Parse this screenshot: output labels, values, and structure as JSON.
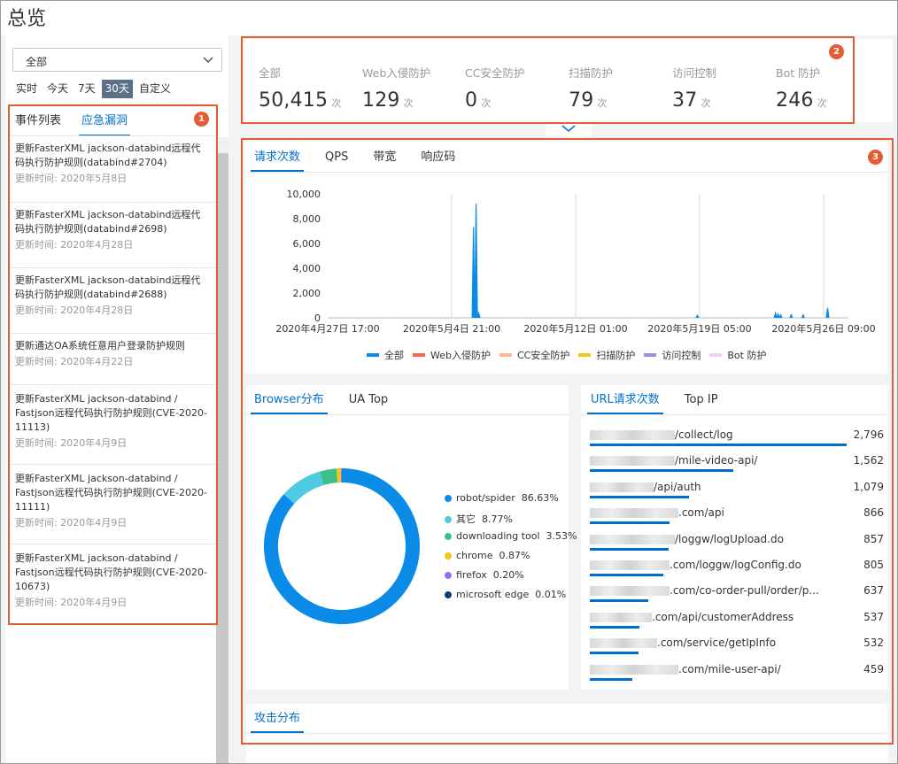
{
  "page": {
    "title": "总览"
  },
  "filter": {
    "select_value": "全部",
    "ranges": [
      "实时",
      "今天",
      "7天",
      "30天",
      "自定义"
    ],
    "active_range": "30天"
  },
  "left_tabs": [
    "事件列表",
    "应急漏洞"
  ],
  "events": [
    {
      "title": "更新FasterXML jackson-databind远程代码执行防护规则(databind#2704)",
      "date": "更新时间: 2020年5月8日"
    },
    {
      "title": "更新FasterXML jackson-databind远程代码执行防护规则(databind#2698)",
      "date": "更新时间: 2020年4月28日"
    },
    {
      "title": "更新FasterXML jackson-databind远程代码执行防护规则(databind#2688)",
      "date": "更新时间: 2020年4月28日"
    },
    {
      "title": "更新通达OA系统任意用户登录防护规则",
      "date": "更新时间: 2020年4月22日"
    },
    {
      "title": "更新FasterXML jackson-databind / Fastjson远程代码执行防护规则(CVE-2020-11113)",
      "date": "更新时间: 2020年4月9日"
    },
    {
      "title": "更新FasterXML jackson-databind / Fastjson远程代码执行防护规则(CVE-2020-11111)",
      "date": "更新时间: 2020年4月9日"
    },
    {
      "title": "更新FasterXML jackson-databind / Fastjson远程代码执行防护规则(CVE-2020-10673)",
      "date": "更新时间: 2020年4月9日"
    }
  ],
  "badges": [
    "1",
    "2",
    "3"
  ],
  "stats": [
    {
      "label": "全部",
      "value": "50,415",
      "unit": "次"
    },
    {
      "label": "Web入侵防护",
      "value": "129",
      "unit": "次"
    },
    {
      "label": "CC安全防护",
      "value": "0",
      "unit": "次"
    },
    {
      "label": "扫描防护",
      "value": "79",
      "unit": "次"
    },
    {
      "label": "访问控制",
      "value": "37",
      "unit": "次"
    },
    {
      "label": "Bot 防护",
      "value": "246",
      "unit": "次"
    }
  ],
  "chart_tabs": [
    "请求次数",
    "QPS",
    "带宽",
    "响应码"
  ],
  "chart_data": [
    {
      "type": "line",
      "x_tick_labels": [
        "2020年4月27日 17:00",
        "2020年5月4日 21:00",
        "2020年5月12日 01:00",
        "2020年5月19日 05:00",
        "2020年5月26日 09:00"
      ],
      "y_tick_labels": [
        "10,000",
        "8,000",
        "6,000",
        "4,000",
        "2,000",
        "0"
      ],
      "ylim": [
        0,
        10000
      ],
      "legend": [
        {
          "name": "全部",
          "color": "#0a8be8"
        },
        {
          "name": "Web入侵防护",
          "color": "#f46a4a"
        },
        {
          "name": "CC安全防护",
          "color": "#fdb98c"
        },
        {
          "name": "扫描防护",
          "color": "#f5c518"
        },
        {
          "name": "访问控制",
          "color": "#9a8cf0"
        },
        {
          "name": "Bot 防护",
          "color": "#f3cdf3"
        }
      ],
      "series": [
        {
          "name": "全部",
          "spikes": [
            {
              "t": 0.28,
              "v": 7300
            },
            {
              "t": 0.285,
              "v": 9200
            },
            {
              "t": 0.29,
              "v": 400
            },
            {
              "t": 0.71,
              "v": 200
            },
            {
              "t": 0.86,
              "v": 400
            },
            {
              "t": 0.865,
              "v": 300
            },
            {
              "t": 0.87,
              "v": 250
            },
            {
              "t": 0.89,
              "v": 250
            },
            {
              "t": 0.913,
              "v": 250
            },
            {
              "t": 0.96,
              "v": 800
            }
          ]
        }
      ]
    },
    {
      "type": "pie",
      "labels": [
        "robot/spider",
        "其它",
        "downloading tool",
        "chrome",
        "firefox",
        "microsoft edge"
      ],
      "values": [
        86.63,
        8.77,
        3.53,
        0.87,
        0.2,
        0.01
      ],
      "display": [
        "86.63%",
        "8.77%",
        "3.53%",
        "0.87%",
        "0.20%",
        "0.01%"
      ],
      "colors": [
        "#0a8be8",
        "#4ecbe0",
        "#3ebf8a",
        "#f5c518",
        "#9a6cf0",
        "#0f3c6e"
      ]
    }
  ],
  "browser_tabs": [
    "Browser分布",
    "UA Top"
  ],
  "url_tabs": [
    "URL请求次数",
    "Top IP"
  ],
  "urls": [
    {
      "path": "/collect/log",
      "count": "2,796",
      "value": 2796
    },
    {
      "path": "/mile-video-api/",
      "count": "1,562",
      "value": 1562
    },
    {
      "path": "/api/auth",
      "count": "1,079",
      "value": 1079
    },
    {
      "path": ".com/api",
      "count": "866",
      "value": 866
    },
    {
      "path": "/loggw/logUpload.do",
      "count": "857",
      "value": 857
    },
    {
      "path": ".com/loggw/logConfig.do",
      "count": "805",
      "value": 805
    },
    {
      "path": ".com/co-order-pull/order/p...",
      "count": "637",
      "value": 637
    },
    {
      "path": ".com/api/customerAddress",
      "count": "537",
      "value": 537
    },
    {
      "path": ".com/service/getIpInfo",
      "count": "532",
      "value": 532
    },
    {
      "path": ".com/mile-user-api/",
      "count": "459",
      "value": 459
    }
  ],
  "attack_tab": "攻击分布",
  "icons": {
    "dropdown": "chevron-down-icon",
    "expand": "chevron-down-icon"
  }
}
